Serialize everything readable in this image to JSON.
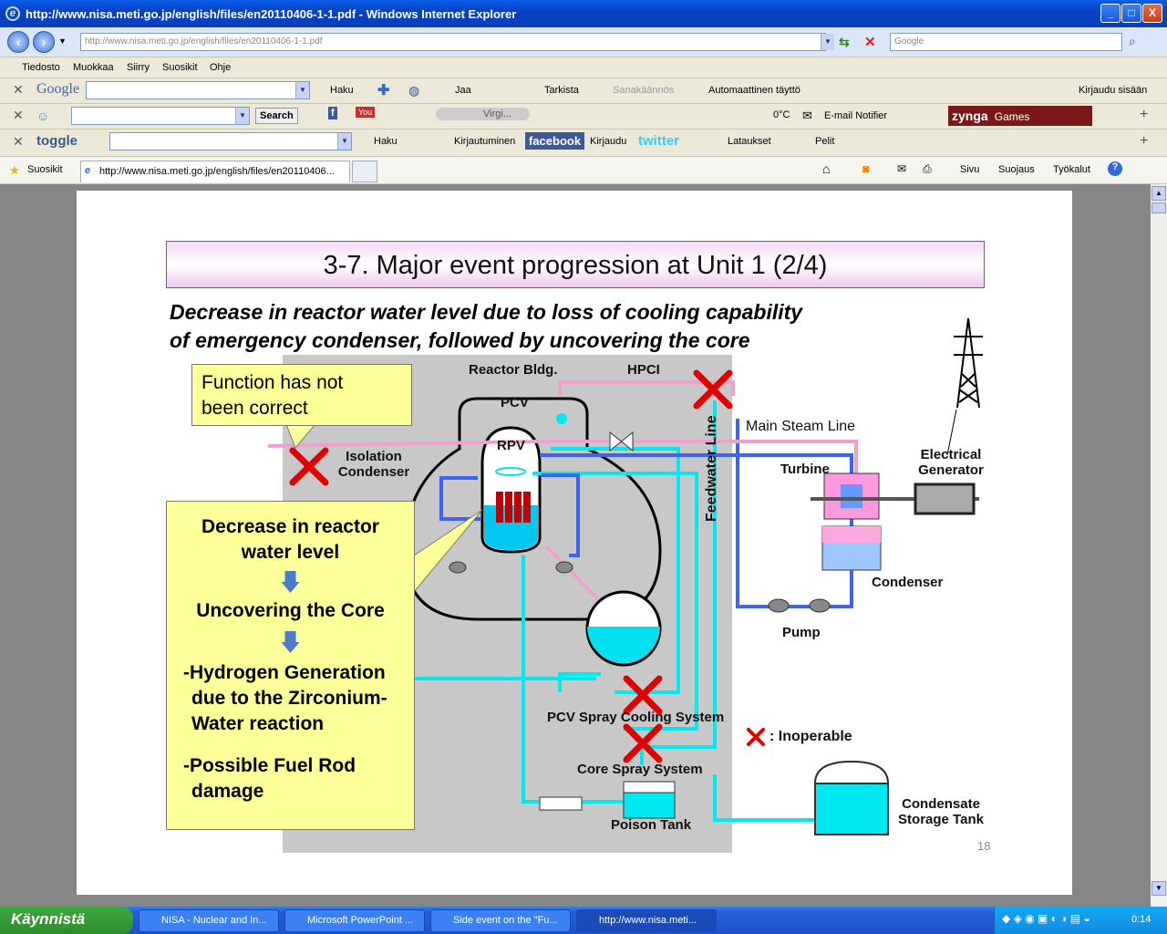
{
  "window": {
    "title": "http://www.nisa.meti.go.jp/english/files/en20110406-1-1.pdf - Windows Internet Explorer",
    "controls": [
      "_",
      "□",
      "X"
    ]
  },
  "address_bar": {
    "url": "http://www.nisa.meti.go.jp/english/files/en20110406-1-1.pdf",
    "search_placeholder": "Google"
  },
  "menu": [
    "Tiedosto",
    "Muokkaa",
    "Siirry",
    "Suosikit",
    "Ohje"
  ],
  "toolbar1": {
    "logo": "Google",
    "items": [
      "Haku",
      "Jaa",
      "Tarkista",
      "Sanakäännös",
      "Automaattinen täyttö",
      "Kirjaudu sisään"
    ]
  },
  "toolbar2": {
    "search_label": "Search",
    "player": "Virgi...",
    "weather": "0°C",
    "email": "E-mail Notifier",
    "games": "Games",
    "zynga": "zynga"
  },
  "toolbar3": {
    "logo": "toggle",
    "items": [
      "Haku",
      "Kirjautuminen",
      "facebook",
      "Kirjaudu",
      "twitter",
      "Lataukset",
      "Pelit"
    ]
  },
  "fav_bar": {
    "favorites": "Suosikit",
    "tab_title": "http://www.nisa.meti.go.jp/english/files/en20110406...",
    "commands": [
      "Sivu",
      "Suojaus",
      "Työkalut"
    ]
  },
  "slide": {
    "title": "3-7. Major event progression at Unit 1 (2/4)",
    "subtitle_line1": "Decrease in reactor water level due to loss of cooling capability",
    "subtitle_line2": "of emergency condenser, followed by uncovering the core",
    "page_number": "18",
    "labels": {
      "reactor_bldg": "Reactor Bldg.",
      "hpci": "HPCI",
      "pcv": "PCV",
      "rpv": "RPV",
      "isolation_condenser_1": "Isolation",
      "isolation_condenser_2": "Condenser",
      "main_steam_line": "Main Steam Line",
      "turbine": "Turbine",
      "generator_1": "Electrical",
      "generator_2": "Generator",
      "feedwater_line": "Feedwater Line",
      "condenser": "Condenser",
      "pump": "Pump",
      "pcv_spray": "PCV Spray Cooling System",
      "core_spray": "Core Spray System",
      "poison_tank": "Poison Tank",
      "condensate_1": "Condensate",
      "condensate_2": "Storage Tank",
      "inoperable": ": Inoperable"
    },
    "callout_top": [
      "Function has not",
      "been correct"
    ],
    "callout_main": {
      "line1": "Decrease in reactor",
      "line2": "water level",
      "step2": "Uncovering the Core",
      "step3a": "-Hydrogen Generation",
      "step3b": "due to the Zirconium-",
      "step3c": "Water reaction",
      "step4a": "-Possible Fuel Rod",
      "step4b": "damage"
    }
  },
  "taskbar": {
    "start": "Käynnistä",
    "tasks": [
      "NISA - Nuclear and In...",
      "Microsoft PowerPoint ...",
      "Side event on the \"Fu...",
      "http://www.nisa.meti..."
    ],
    "clock": "0:14"
  }
}
